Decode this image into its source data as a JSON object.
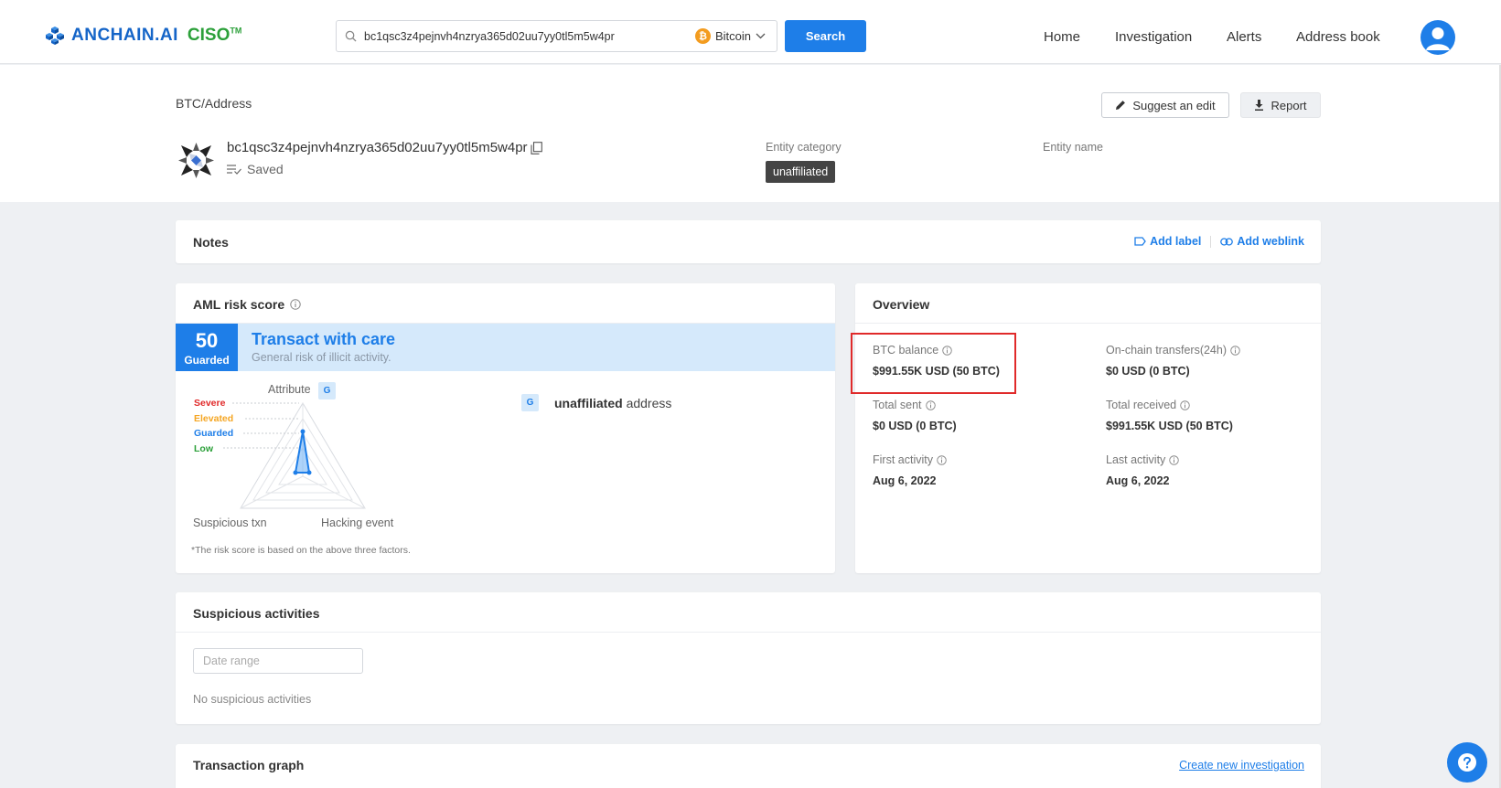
{
  "header": {
    "brand": "ANCHAIN.AI",
    "product": "CISO",
    "trademark": "TM",
    "search": {
      "value": "bc1qsc3z4pejnvh4nzrya365d02uu7yy0tl5m5w4pr",
      "placeholder": "",
      "coin_label": "Bitcoin",
      "coin_symbol": "₿",
      "button_label": "Search"
    },
    "nav": [
      "Home",
      "Investigation",
      "Alerts",
      "Address book"
    ]
  },
  "address": {
    "breadcrumb": "BTC/Address",
    "value": "bc1qsc3z4pejnvh4nzrya365d02uu7yy0tl5m5w4pr",
    "saved_label": "Saved",
    "suggest_edit": "Suggest an edit",
    "report": "Report",
    "entity_category_label": "Entity category",
    "entity_category": "unaffiliated",
    "entity_name_label": "Entity name"
  },
  "notes": {
    "title": "Notes",
    "add_label": "Add label",
    "add_weblink": "Add weblink"
  },
  "aml": {
    "title": "AML risk score",
    "score": "50",
    "level": "Guarded",
    "headline": "Transact with care",
    "subline": "General risk of illicit activity.",
    "levels": [
      {
        "name": "Severe",
        "color": "#e02a2a"
      },
      {
        "name": "Elevated",
        "color": "#f5a623"
      },
      {
        "name": "Guarded",
        "color": "#1e7ee8"
      },
      {
        "name": "Low",
        "color": "#2ca03a"
      }
    ],
    "axes": {
      "attribute": "Attribute",
      "suspicious": "Suspicious txn",
      "hacking": "Hacking event"
    },
    "tag": "G",
    "attribute_tag": "G",
    "attribute_bold": "unaffiliated",
    "attribute_rest": "address",
    "footnote": "*The risk score is based on the above three factors."
  },
  "overview": {
    "title": "Overview",
    "items": [
      {
        "label": "BTC balance",
        "value": "$991.55K USD (50 BTC)"
      },
      {
        "label": "On-chain transfers(24h)",
        "value": "$0 USD (0 BTC)"
      },
      {
        "label": "Total sent",
        "value": "$0 USD (0 BTC)"
      },
      {
        "label": "Total received",
        "value": "$991.55K USD (50 BTC)"
      },
      {
        "label": "First activity",
        "value": "Aug 6, 2022"
      },
      {
        "label": "Last activity",
        "value": "Aug 6, 2022"
      }
    ]
  },
  "suspicious": {
    "title": "Suspicious activities",
    "date_placeholder": "Date range",
    "empty": "No suspicious activities"
  },
  "graph": {
    "title": "Transaction graph",
    "create_link": "Create new investigation"
  },
  "colors": {
    "accent": "#1e7ee8",
    "highlight": "#e02a2a",
    "btc": "#f39c1f"
  }
}
